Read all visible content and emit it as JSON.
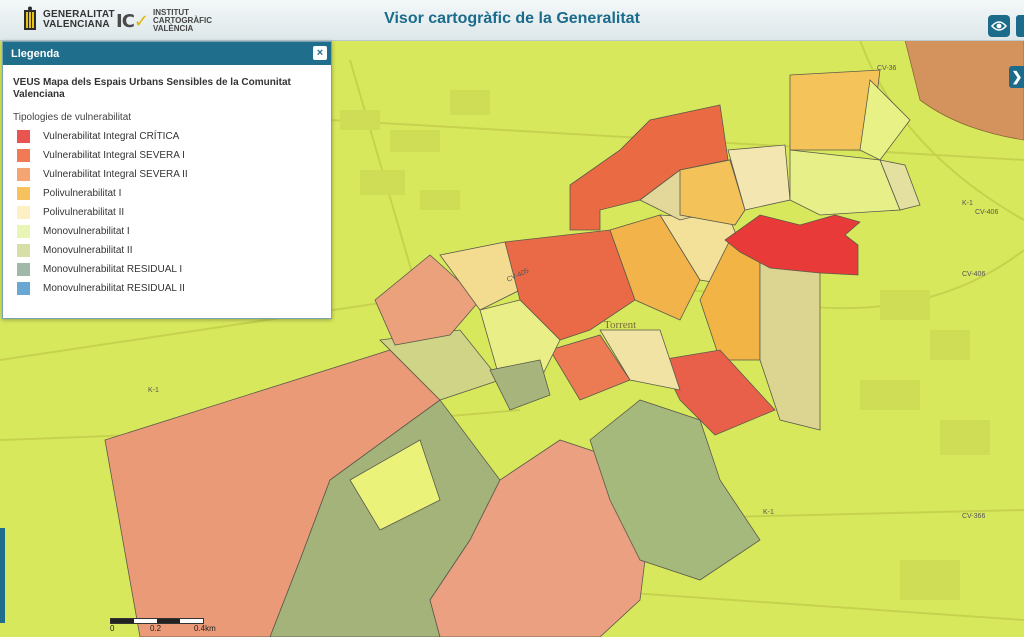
{
  "header": {
    "gv_line1": "GENERALITAT",
    "gv_line2": "VALENCIANA",
    "icv_mark": "IC",
    "icv_line1": "INSTITUT",
    "icv_line2": "CARTOGRÀFIC",
    "icv_line3": "VALÈNCIA",
    "title": "Visor cartogràfic de la Generalitat"
  },
  "legend": {
    "header": "Llegenda",
    "close_label": "×",
    "layer_title": "VEUS Mapa dels Espais Urbans Sensibles de la Comunitat Valenciana",
    "subtitle": "Tipologies de vulnerabilitat",
    "items": [
      {
        "label": "Vulnerabilitat Integral CRÍTICA",
        "color": "#e8544f"
      },
      {
        "label": "Vulnerabilitat Integral SEVERA I",
        "color": "#ef7a55"
      },
      {
        "label": "Vulnerabilitat Integral SEVERA II",
        "color": "#f4a571"
      },
      {
        "label": "Polivulnerabilitat I",
        "color": "#f7c25e"
      },
      {
        "label": "Polivulnerabilitat II",
        "color": "#fdf0c4"
      },
      {
        "label": "Monovulnerabilitat I",
        "color": "#e8f5b4"
      },
      {
        "label": "Monovulnerabilitat II",
        "color": "#d7dea7"
      },
      {
        "label": "Monovulnerabilitat RESIDUAL I",
        "color": "#9fb8a8"
      },
      {
        "label": "Monovulnerabilitat RESIDUAL II",
        "color": "#6aa8d4"
      }
    ]
  },
  "map": {
    "town_label": "Torrent",
    "road_labels": [
      "CV-36",
      "CV-405",
      "CV-406",
      "CV-406",
      "K-1",
      "K-1",
      "K-1",
      "CV-366"
    ]
  },
  "scale": {
    "labels": [
      "0",
      "0.2",
      "0.4km"
    ]
  },
  "controls": {
    "expand_label": "❯"
  }
}
